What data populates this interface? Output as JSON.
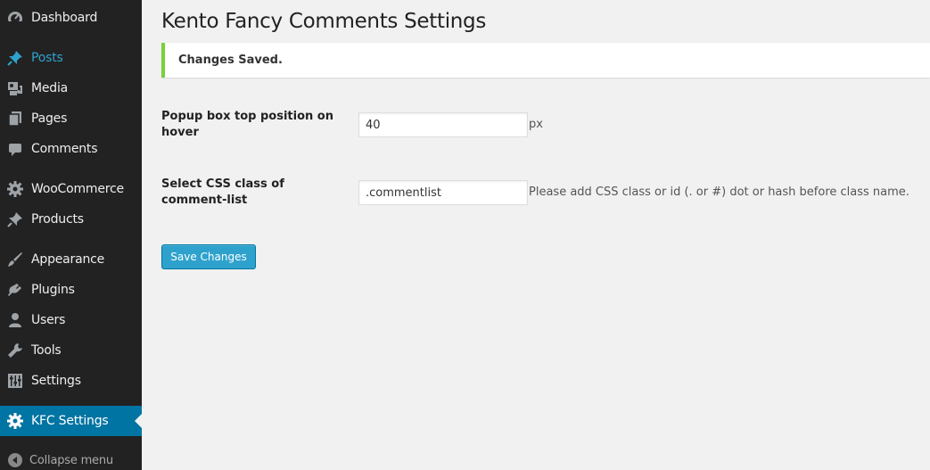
{
  "sidebar": {
    "items": [
      {
        "label": "Dashboard",
        "icon": "dashboard-icon"
      },
      {
        "label": "Posts",
        "icon": "pin-icon"
      },
      {
        "label": "Media",
        "icon": "media-icon"
      },
      {
        "label": "Pages",
        "icon": "pages-icon"
      },
      {
        "label": "Comments",
        "icon": "comment-icon"
      },
      {
        "label": "WooCommerce",
        "icon": "gear-icon"
      },
      {
        "label": "Products",
        "icon": "pin-icon"
      },
      {
        "label": "Appearance",
        "icon": "brush-icon"
      },
      {
        "label": "Plugins",
        "icon": "plug-icon"
      },
      {
        "label": "Users",
        "icon": "user-icon"
      },
      {
        "label": "Tools",
        "icon": "wrench-icon"
      },
      {
        "label": "Settings",
        "icon": "sliders-icon"
      },
      {
        "label": "KFC Settings",
        "icon": "gear-icon"
      }
    ],
    "collapse_label": "Collapse menu"
  },
  "main": {
    "title": "Kento Fancy Comments Settings",
    "notice": "Changes Saved.",
    "fields": [
      {
        "label": "Popup box top position on hover",
        "value": "40",
        "suffix": "px"
      },
      {
        "label": "Select CSS class of comment-list",
        "value": ".commentlist",
        "suffix": "Please add CSS class or id (. or #) dot or hash before class name."
      }
    ],
    "save_label": "Save Changes"
  },
  "colors": {
    "sidebar_bg": "#222222",
    "active_blue": "#2ea2cc",
    "current_bg": "#0074a2",
    "notice_border": "#7ad03a",
    "button_bg": "#2ea2cc"
  }
}
